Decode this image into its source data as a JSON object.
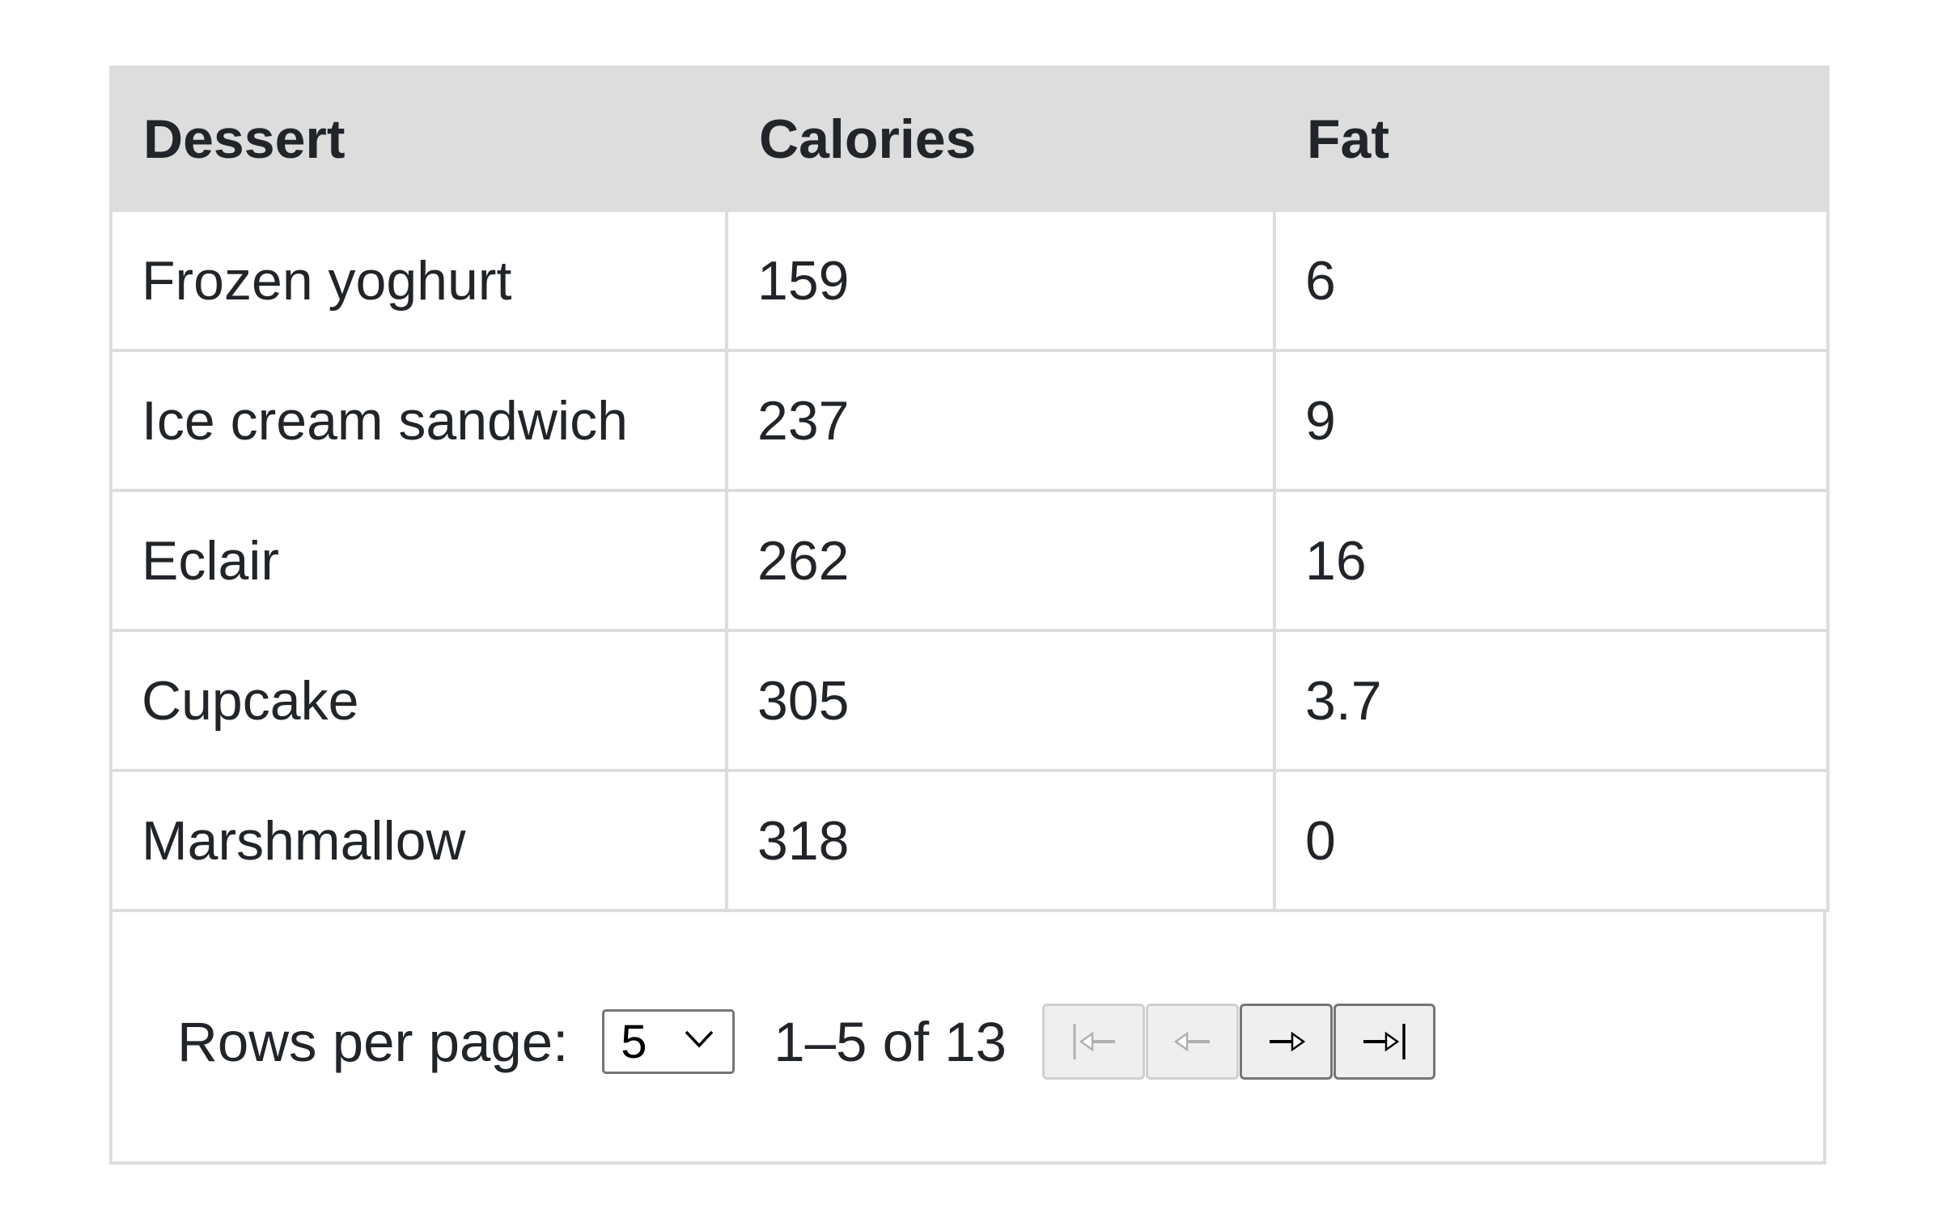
{
  "table": {
    "columns": [
      "Dessert",
      "Calories",
      "Fat"
    ],
    "rows": [
      {
        "dessert": "Frozen yoghurt",
        "calories": "159",
        "fat": "6"
      },
      {
        "dessert": "Ice cream sandwich",
        "calories": "237",
        "fat": "9"
      },
      {
        "dessert": "Eclair",
        "calories": "262",
        "fat": "16"
      },
      {
        "dessert": "Cupcake",
        "calories": "305",
        "fat": "3.7"
      },
      {
        "dessert": "Marshmallow",
        "calories": "318",
        "fat": "0"
      }
    ]
  },
  "pagination": {
    "rows_per_page_label": "Rows per page:",
    "rows_per_page_value": "5",
    "range_text": "1–5 of 13",
    "buttons": [
      {
        "name": "first-page",
        "icon": "first-page-icon",
        "disabled": true
      },
      {
        "name": "previous-page",
        "icon": "previous-page-icon",
        "disabled": true
      },
      {
        "name": "next-page",
        "icon": "next-page-icon",
        "disabled": false
      },
      {
        "name": "last-page",
        "icon": "last-page-icon",
        "disabled": false
      }
    ]
  },
  "colors": {
    "header_bg": "#dddddd",
    "border": "#dddddd",
    "text": "#212529",
    "disabled_icon": "#b0b0b0",
    "enabled_icon": "#000000"
  }
}
